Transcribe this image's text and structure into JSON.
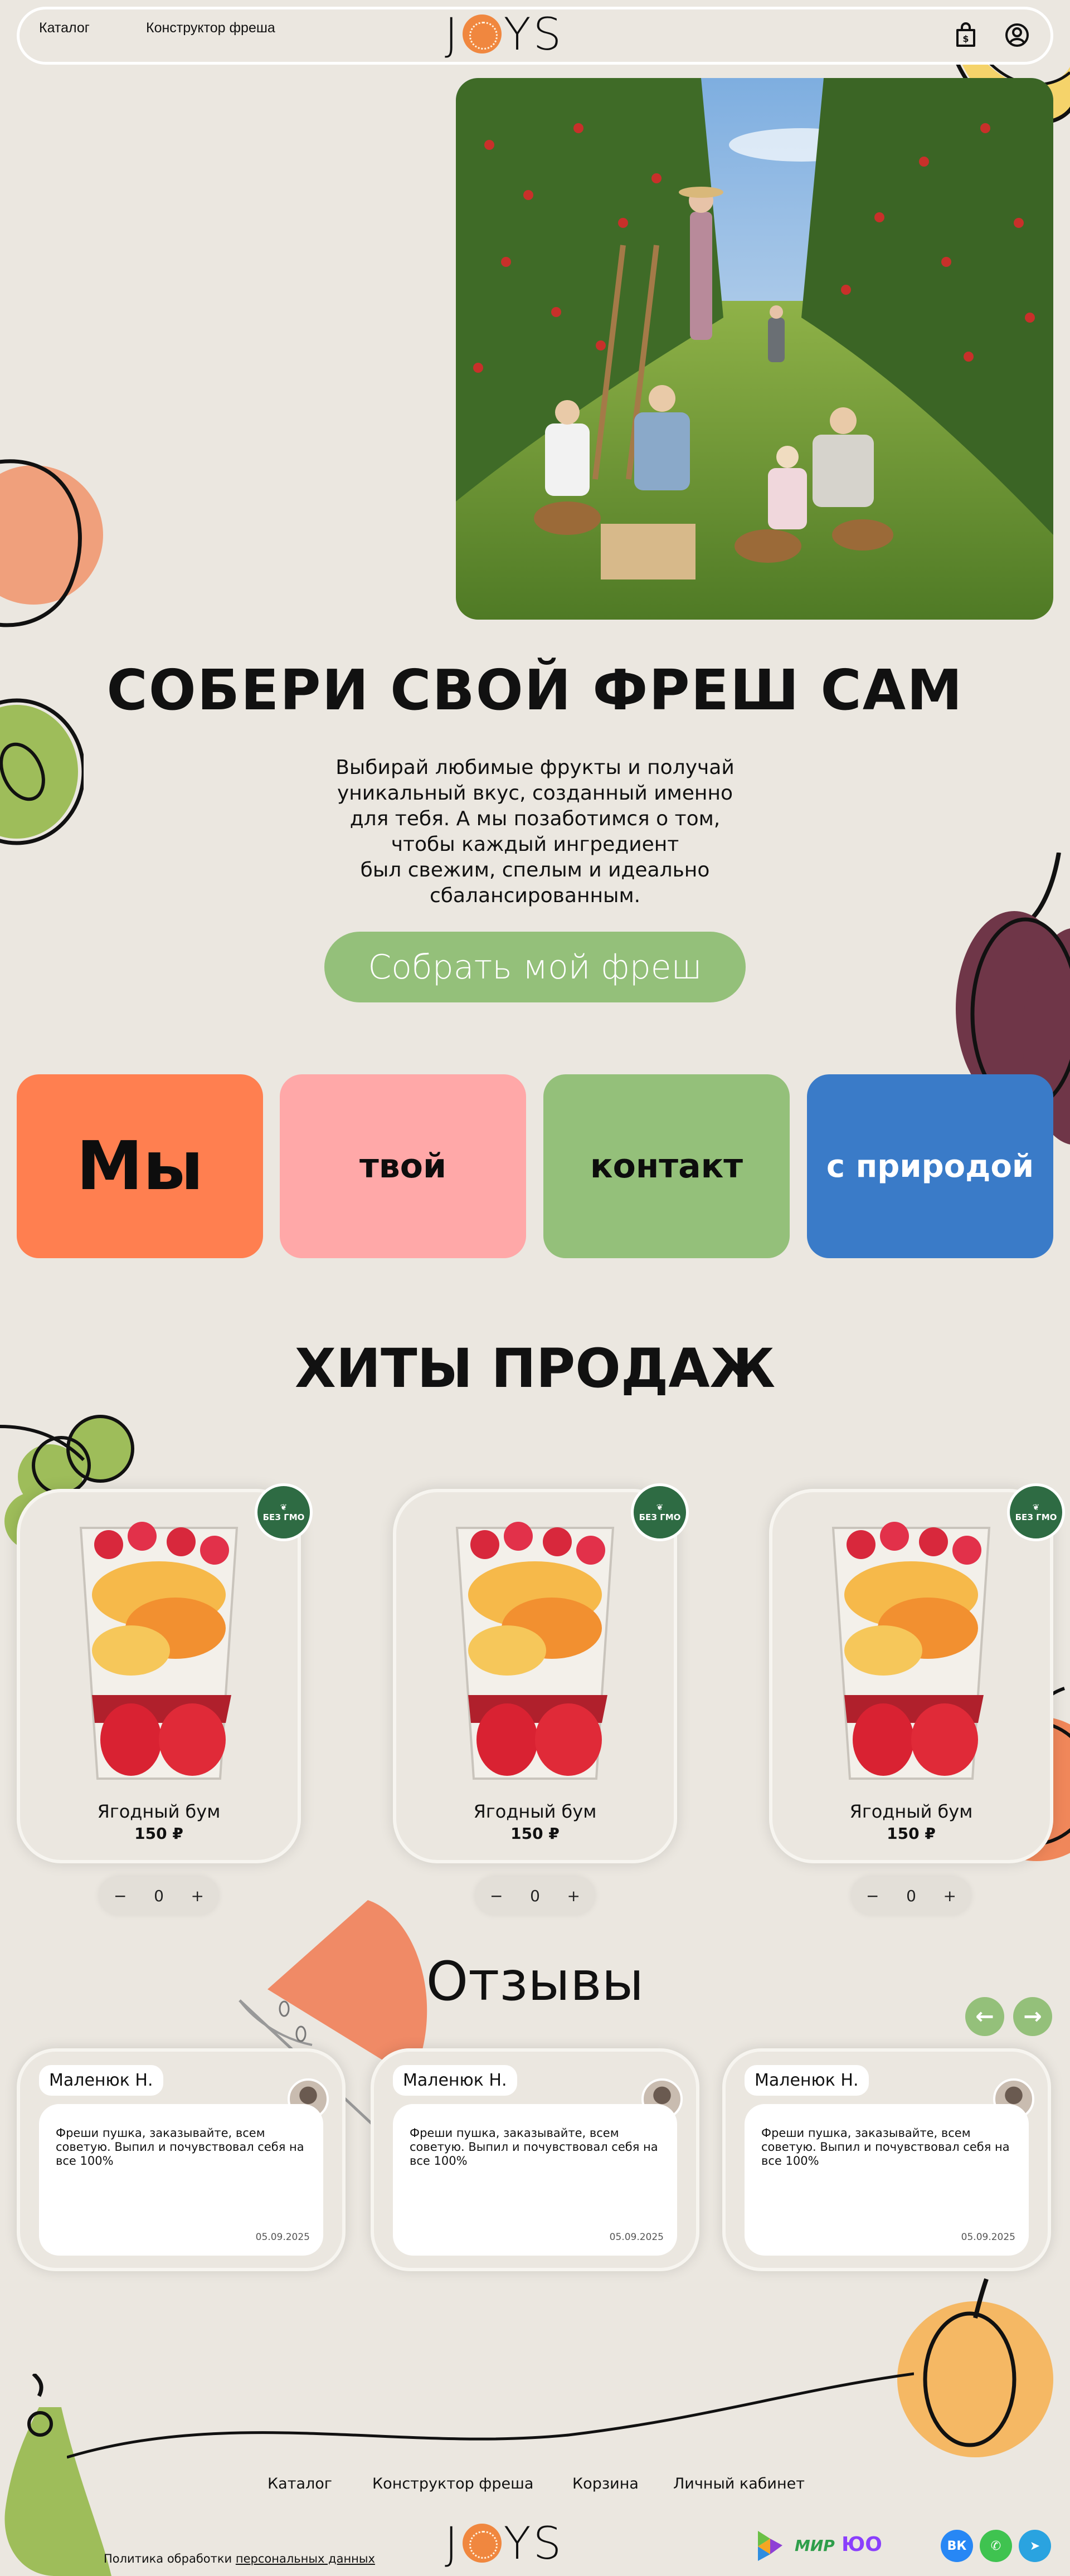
{
  "colors": {
    "background": "#ebe7e0",
    "accent_green": "#94c07a",
    "orange": "#ff7f50",
    "pink": "#ffa8a8",
    "blue": "#3a7bc8",
    "badge_green": "#2e6b43"
  },
  "header": {
    "nav": [
      "Каталог",
      "Конструктор фреша"
    ],
    "logo": {
      "prefix": "J",
      "suffix": "YS"
    },
    "icons": [
      "shopping-bag-icon",
      "user-icon"
    ]
  },
  "hero": {
    "title": "СОБЕРИ СВОЙ ФРЕШ САМ",
    "text_lines": [
      "Выбирай любимые фрукты и получай",
      "уникальный вкус, созданный именно",
      "для тебя. А мы позаботимся о том,",
      "чтобы каждый ингредиент",
      "был свежим, спелым и идеально",
      "сбалансированным."
    ],
    "cta": "Собрать мой фреш"
  },
  "tiles": [
    "Мы",
    "твой",
    "контакт",
    "с природой"
  ],
  "hits": {
    "title": "ХИТЫ ПРОДАЖ",
    "badge_text": "БЕЗ ГМО",
    "products": [
      {
        "name": "Ягодный бум",
        "price": "150 ₽",
        "qty": "0"
      },
      {
        "name": "Ягодный бум",
        "price": "150 ₽",
        "qty": "0"
      },
      {
        "name": "Ягодный бум",
        "price": "150 ₽",
        "qty": "0"
      }
    ],
    "minus": "−",
    "plus": "+"
  },
  "reviews": {
    "title": "Отзывы",
    "prev_icon": "arrow-left-icon",
    "next_icon": "arrow-right-icon",
    "items": [
      {
        "author": "Маленюк Н.",
        "text": "Фреши пушка, заказывайте, всем советую. Выпил и почувствовал себя на все 100%",
        "date": "05.09.2025"
      },
      {
        "author": "Маленюк Н.",
        "text": "Фреши пушка, заказывайте, всем советую. Выпил и почувствовал себя на все 100%",
        "date": "05.09.2025"
      },
      {
        "author": "Маленюк Н.",
        "text": "Фреши пушка, заказывайте, всем советую. Выпил и почувствовал себя на все 100%",
        "date": "05.09.2025"
      }
    ]
  },
  "footer": {
    "links": [
      "Каталог",
      "Конструктор фреша",
      "Корзина",
      "Личный кабинет"
    ],
    "policy_prefix": "Политика обработки",
    "policy_link": "персональных данных",
    "payments": {
      "mir": "МИР",
      "yoomoney": "ЮО"
    },
    "social": [
      "vk-icon",
      "whatsapp-icon",
      "telegram-icon"
    ],
    "vk_label": "ВК"
  }
}
